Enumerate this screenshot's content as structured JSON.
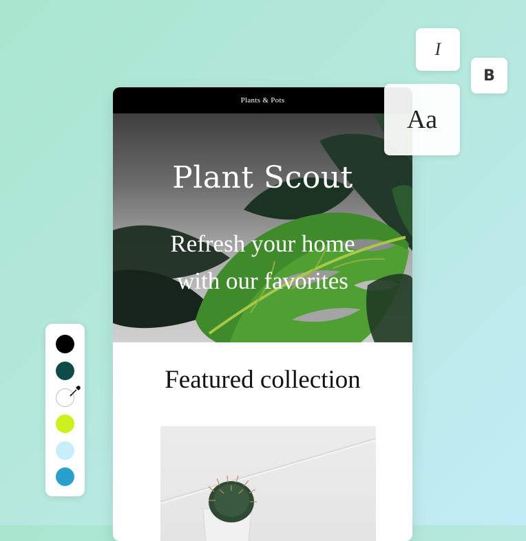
{
  "email_preview": {
    "brand_bar": "Plants & Pots",
    "hero": {
      "title": "Plant Scout",
      "subtitle_line1": "Refresh your home",
      "subtitle_line2": "with our favorites"
    },
    "featured_heading": "Featured collection"
  },
  "font_controls": {
    "italic_label": "I",
    "bold_label": "B",
    "typeface_label": "Aa"
  },
  "color_palette": {
    "swatches": [
      "#000000",
      "#0d4a4a",
      "#ffffff",
      "#cdf01f",
      "#c7eef9",
      "#2aa1cc"
    ],
    "eyedropper_icon": "eyedropper-icon"
  }
}
